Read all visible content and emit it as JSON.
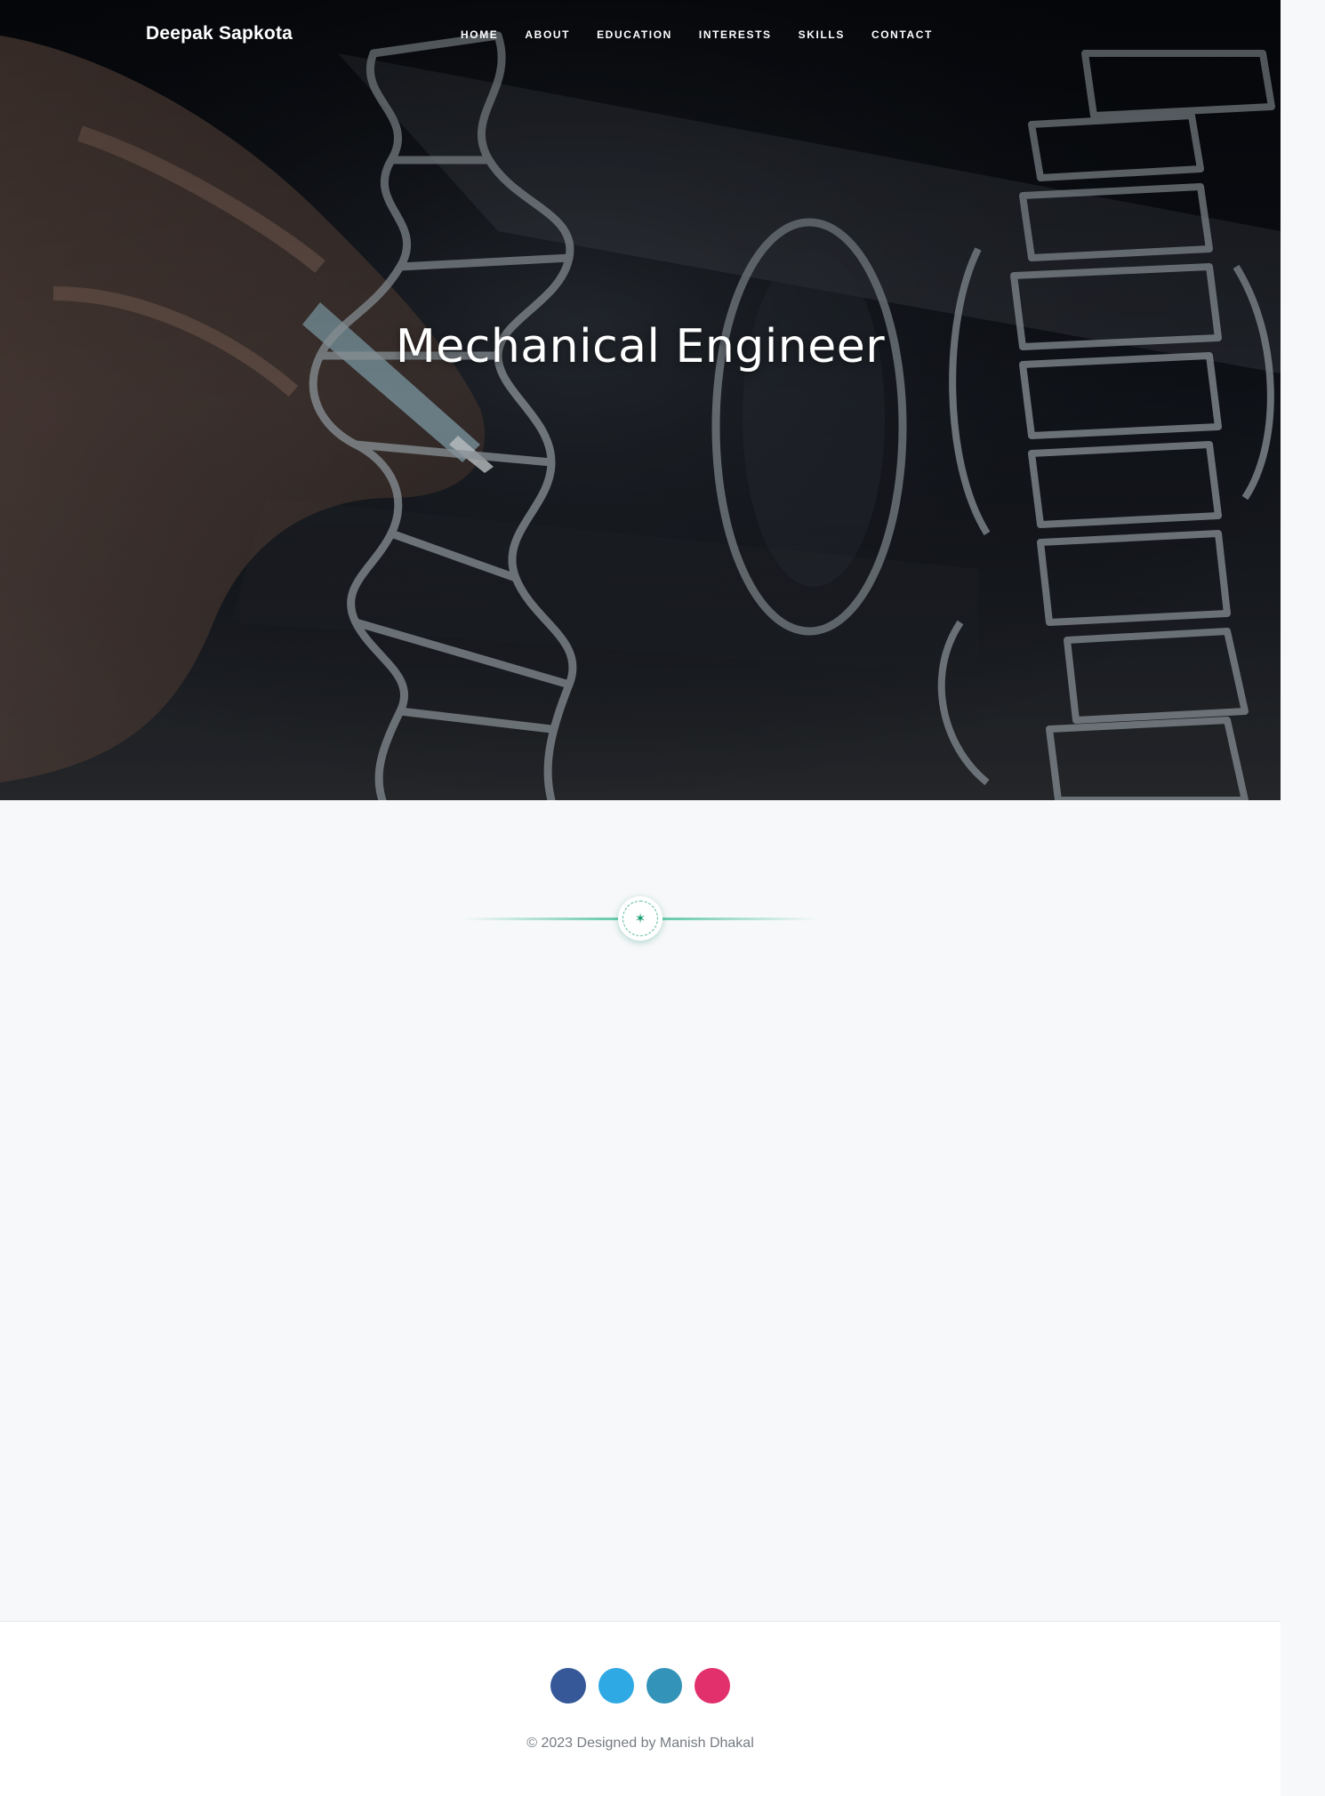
{
  "navbar": {
    "brand": "Deepak Sapkota",
    "links": [
      "HOME",
      "ABOUT",
      "EDUCATION",
      "INTERESTS",
      "SKILLS",
      "CONTACT"
    ]
  },
  "hero": {
    "title": "Mechanical Engineer"
  },
  "divider": {
    "icon": "asterisk-icon",
    "glyph": "✶",
    "accent_color": "#57c4a0"
  },
  "footer": {
    "social": [
      {
        "icon": "facebook-icon",
        "color": "#365899"
      },
      {
        "icon": "twitter-icon",
        "color": "#2fa9e4"
      },
      {
        "icon": "linkedin-icon",
        "color": "#3393b8"
      },
      {
        "icon": "dribbble-icon",
        "color": "#e1306c"
      }
    ],
    "copyright": "© 2023 Designed by Manish Dhakal"
  }
}
